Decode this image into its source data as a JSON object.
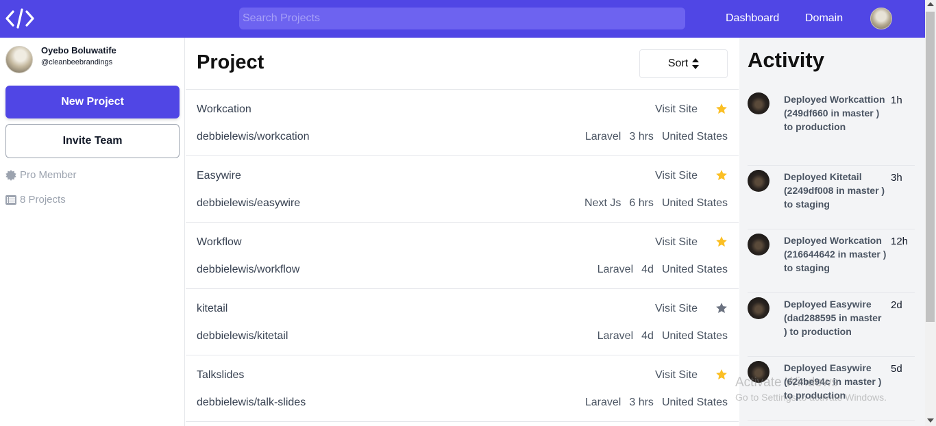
{
  "header": {
    "logo_icon": "code-brackets-icon",
    "search_placeholder": "Search Projects",
    "nav": [
      "Dashboard",
      "Domain"
    ],
    "brand_color": "#5046e5"
  },
  "sidebar": {
    "user_name": "Oyebo Boluwatife",
    "user_handle": "@cleanbeebrandings",
    "new_project_label": "New Project",
    "invite_team_label": "Invite Team",
    "pro_member_label": "Pro Member",
    "projects_count_label": "8 Projects"
  },
  "main": {
    "title": "Project",
    "sort_label": "Sort",
    "projects": [
      {
        "name": "Workcation",
        "repo": "debbielewis/workcation",
        "visit": "Visit Site",
        "framework": "Laravel",
        "age": "3 hrs",
        "location": "United States",
        "starred": true
      },
      {
        "name": "Easywire",
        "repo": "debbielewis/easywire",
        "visit": "Visit Site",
        "framework": "Next Js",
        "age": "6 hrs",
        "location": "United States",
        "starred": true
      },
      {
        "name": "Workflow",
        "repo": "debbielewis/workflow",
        "visit": "Visit Site",
        "framework": "Laravel",
        "age": "4d",
        "location": "United States",
        "starred": true
      },
      {
        "name": "kitetail",
        "repo": "debbielewis/kitetail",
        "visit": "Visit Site",
        "framework": "Laravel",
        "age": "4d",
        "location": "United States",
        "starred": false
      },
      {
        "name": "Talkslides",
        "repo": "debbielewis/talk-slides",
        "visit": "Visit Site",
        "framework": "Laravel",
        "age": "3 hrs",
        "location": "United States",
        "starred": true
      }
    ],
    "star_color_active": "#fbbf24",
    "star_color_inactive": "#6b7280"
  },
  "activity": {
    "title": "Activity",
    "items": [
      {
        "text": "Deployed Workcattion (249df660 in master ) to production",
        "time": "1h"
      },
      {
        "text": "Deployed Kitetail (2249df008 in master ) to staging",
        "time": "3h"
      },
      {
        "text": "Deployed Workcation (216644642 in master ) to staging",
        "time": "12h"
      },
      {
        "text": "Deployed Easywire (dad288595 in master ) to production",
        "time": "2d"
      },
      {
        "text": "Deployed Easywire (624be94c in master ) to production",
        "time": "5d"
      }
    ]
  },
  "watermark": {
    "line1": "Activate Windows",
    "line2": "Go to Settings to activate Windows."
  }
}
